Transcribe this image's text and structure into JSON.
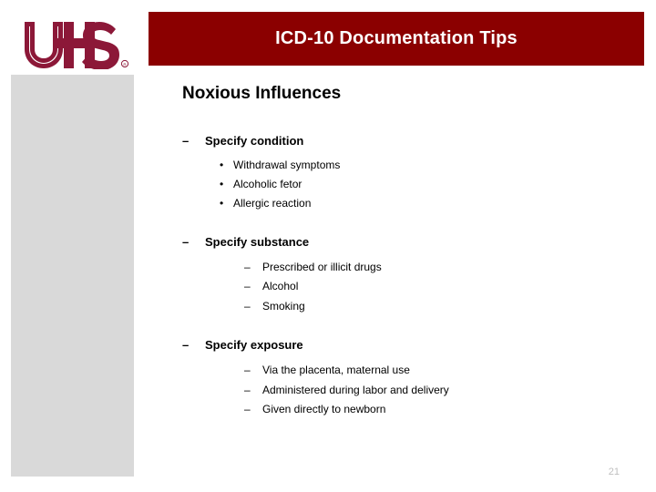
{
  "slide": {
    "header": {
      "title": "ICD-10 Documentation Tips",
      "bar_color": "#8b0000",
      "title_color": "#ffffff"
    },
    "logo": {
      "name": "UHS",
      "alt": "UHS logo",
      "color": "#8c1838",
      "trademark": "®"
    },
    "side_panel": {
      "color": "#d9d9d9"
    },
    "body": {
      "heading": "Noxious Influences",
      "groups": [
        {
          "label": "Specify condition",
          "bullet": "–",
          "children": [
            {
              "text": "Withdrawal symptoms",
              "bullet": "•",
              "level": 2
            },
            {
              "text": "Alcoholic fetor",
              "bullet": "•",
              "level": 2
            },
            {
              "text": "Allergic reaction",
              "bullet": "•",
              "level": 2
            }
          ]
        },
        {
          "label": "Specify substance",
          "bullet": "–",
          "children": [
            {
              "text": "Prescribed or illicit drugs",
              "bullet": "–",
              "level": 3
            },
            {
              "text": "Alcohol",
              "bullet": "–",
              "level": 3
            },
            {
              "text": "Smoking",
              "bullet": "–",
              "level": 3
            }
          ]
        },
        {
          "label": "Specify exposure",
          "bullet": "–",
          "children": [
            {
              "text": "Via the placenta, maternal use",
              "bullet": "–",
              "level": 3
            },
            {
              "text": "Administered during labor and delivery",
              "bullet": "–",
              "level": 3
            },
            {
              "text": "Given directly to newborn",
              "bullet": "–",
              "level": 3
            }
          ]
        }
      ]
    },
    "footer": {
      "page_number": "21",
      "page_number_color": "#bfbfbf"
    }
  }
}
